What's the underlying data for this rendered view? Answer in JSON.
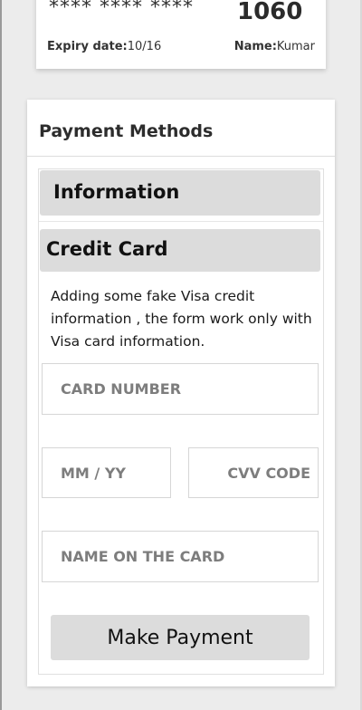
{
  "card_preview": {
    "masked_number": "**** **** ****",
    "last4": "1060",
    "expiry_label": "Expiry date:",
    "expiry_value": "10/16",
    "name_label": "Name:",
    "name_value": "Kumar"
  },
  "payment": {
    "title": "Payment Methods",
    "sections": [
      {
        "label": "Information"
      },
      {
        "label": "Credit Card"
      }
    ],
    "description": "Adding some fake Visa credit information , the form work only with Visa card information.",
    "fields": {
      "card_number": {
        "placeholder": "CARD NUMBER",
        "value": ""
      },
      "expiry": {
        "placeholder": "MM / YY",
        "value": ""
      },
      "cvv": {
        "placeholder": "CVV CODE",
        "value": ""
      },
      "name": {
        "placeholder": "NAME ON THE CARD",
        "value": ""
      }
    },
    "submit_label": "Make Payment"
  }
}
